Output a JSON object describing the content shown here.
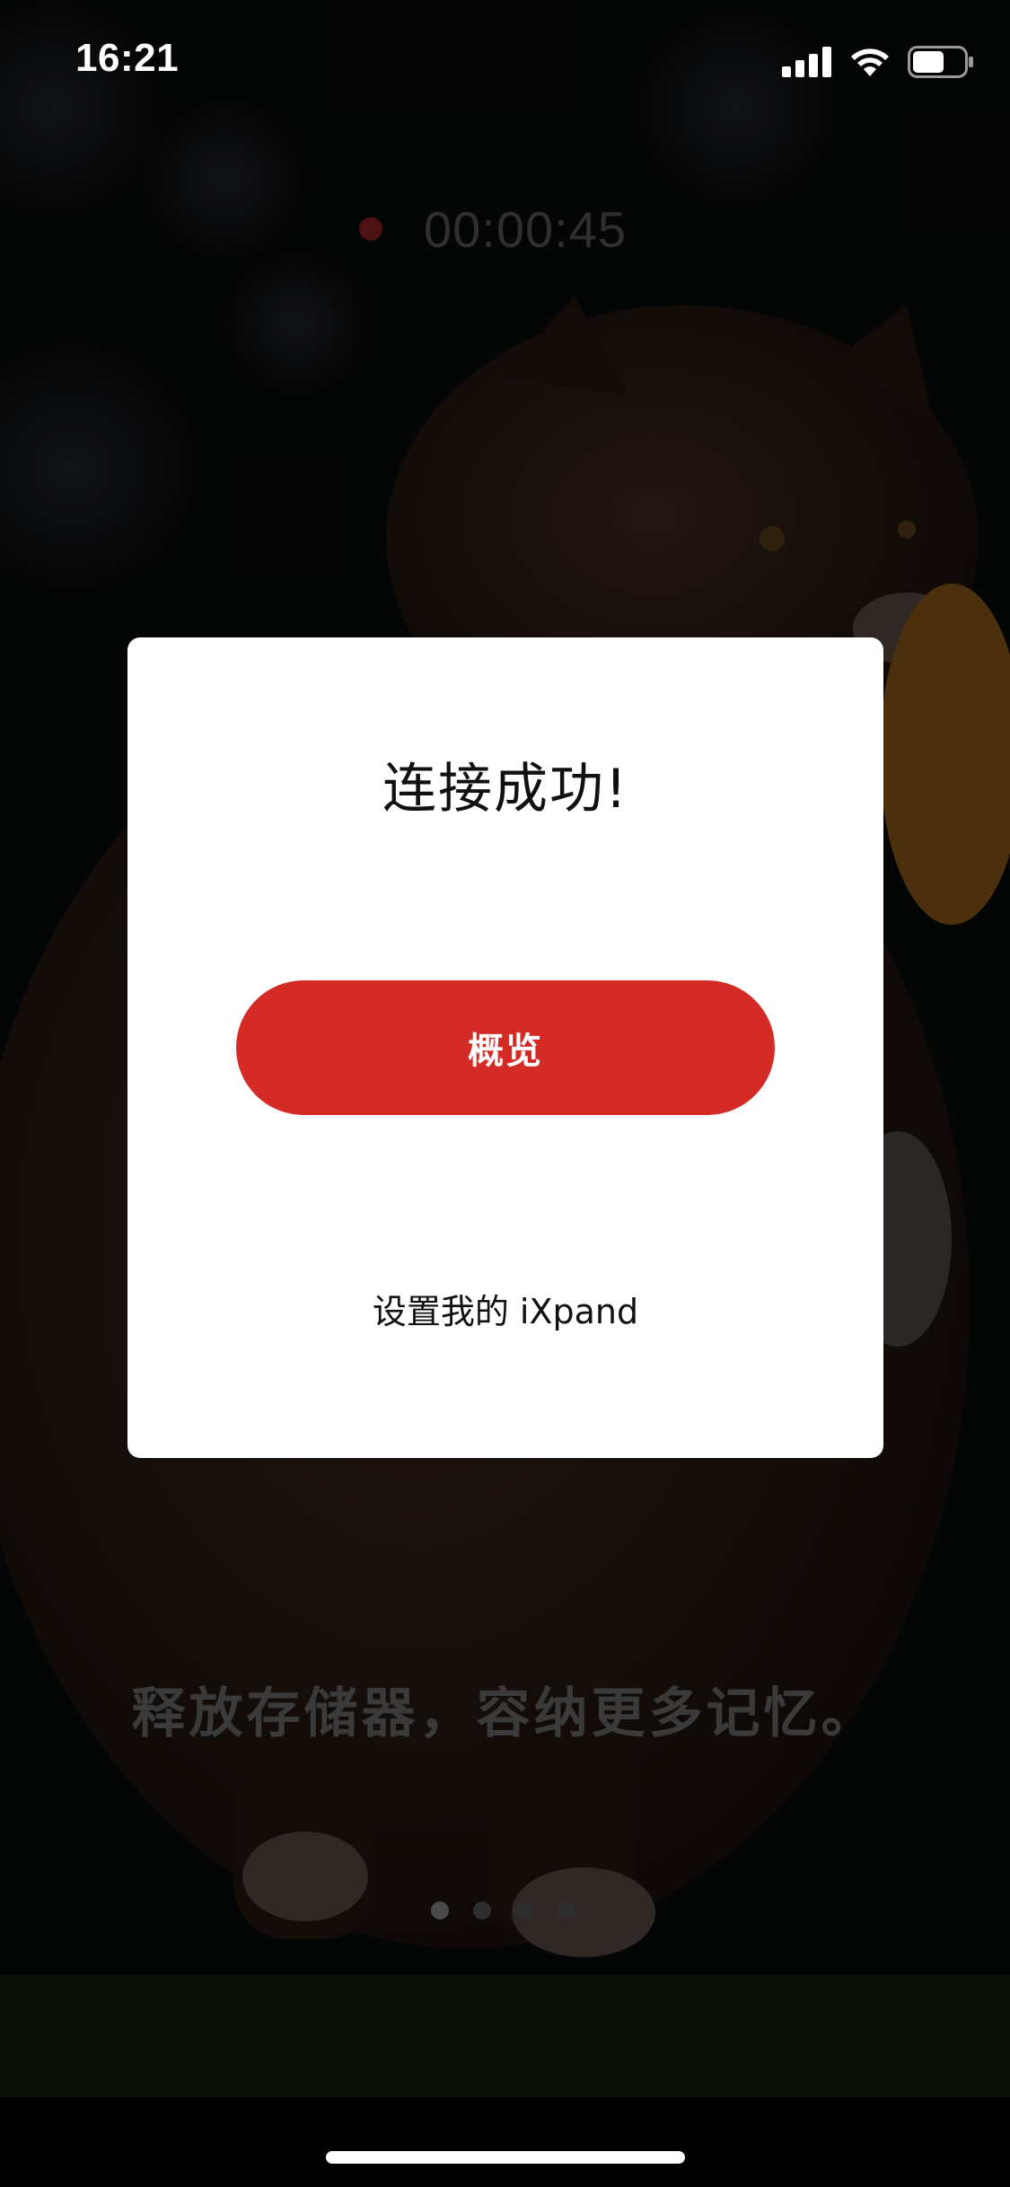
{
  "status_bar": {
    "time": "16:21",
    "icons": [
      "cellular-signal-icon",
      "wifi-icon",
      "battery-icon"
    ]
  },
  "recording": {
    "time": "00:00:45"
  },
  "background": {
    "tagline": "释放存储器，容纳更多记忆。",
    "page_dots": {
      "count": 4,
      "active_index": 0
    }
  },
  "dialog": {
    "title": "连接成功!",
    "primary_button_label": "概览",
    "secondary_link_label": "设置我的 iXpand"
  },
  "colors": {
    "accent": "#d52b27",
    "dialog_background": "#ffffff",
    "screen_background": "#050505"
  }
}
